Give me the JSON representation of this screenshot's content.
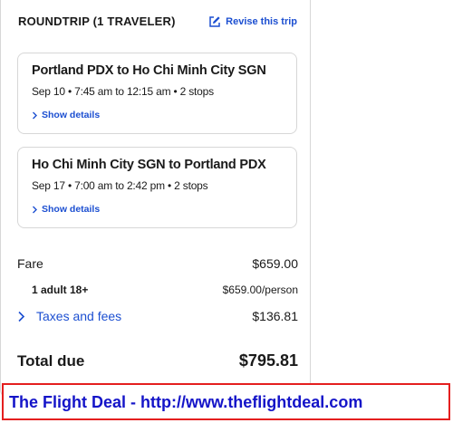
{
  "trip": {
    "title": "ROUNDTRIP (1 TRAVELER)",
    "revise_label": "Revise this trip"
  },
  "flights": [
    {
      "route": "Portland PDX to Ho Chi Minh City SGN",
      "times": "Sep 10 • 7:45 am to 12:15 am • 2 stops",
      "details_label": "Show details"
    },
    {
      "route": "Ho Chi Minh City SGN to Portland PDX",
      "times": "Sep 17 • 7:00 am to 2:42 pm • 2 stops",
      "details_label": "Show details"
    }
  ],
  "price": {
    "fare_label": "Fare",
    "fare_value": "$659.00",
    "adult_label": "1 adult 18+",
    "adult_value": "$659.00/person",
    "taxes_label": "Taxes and fees",
    "taxes_value": "$136.81",
    "total_label": "Total due",
    "total_value": "$795.81"
  },
  "banner": {
    "text": "The Flight Deal - http://www.theflightdeal.com"
  },
  "colors": {
    "link_blue": "#1c4fd1",
    "banner_border": "#e41f1f",
    "banner_text": "#1414c8"
  }
}
